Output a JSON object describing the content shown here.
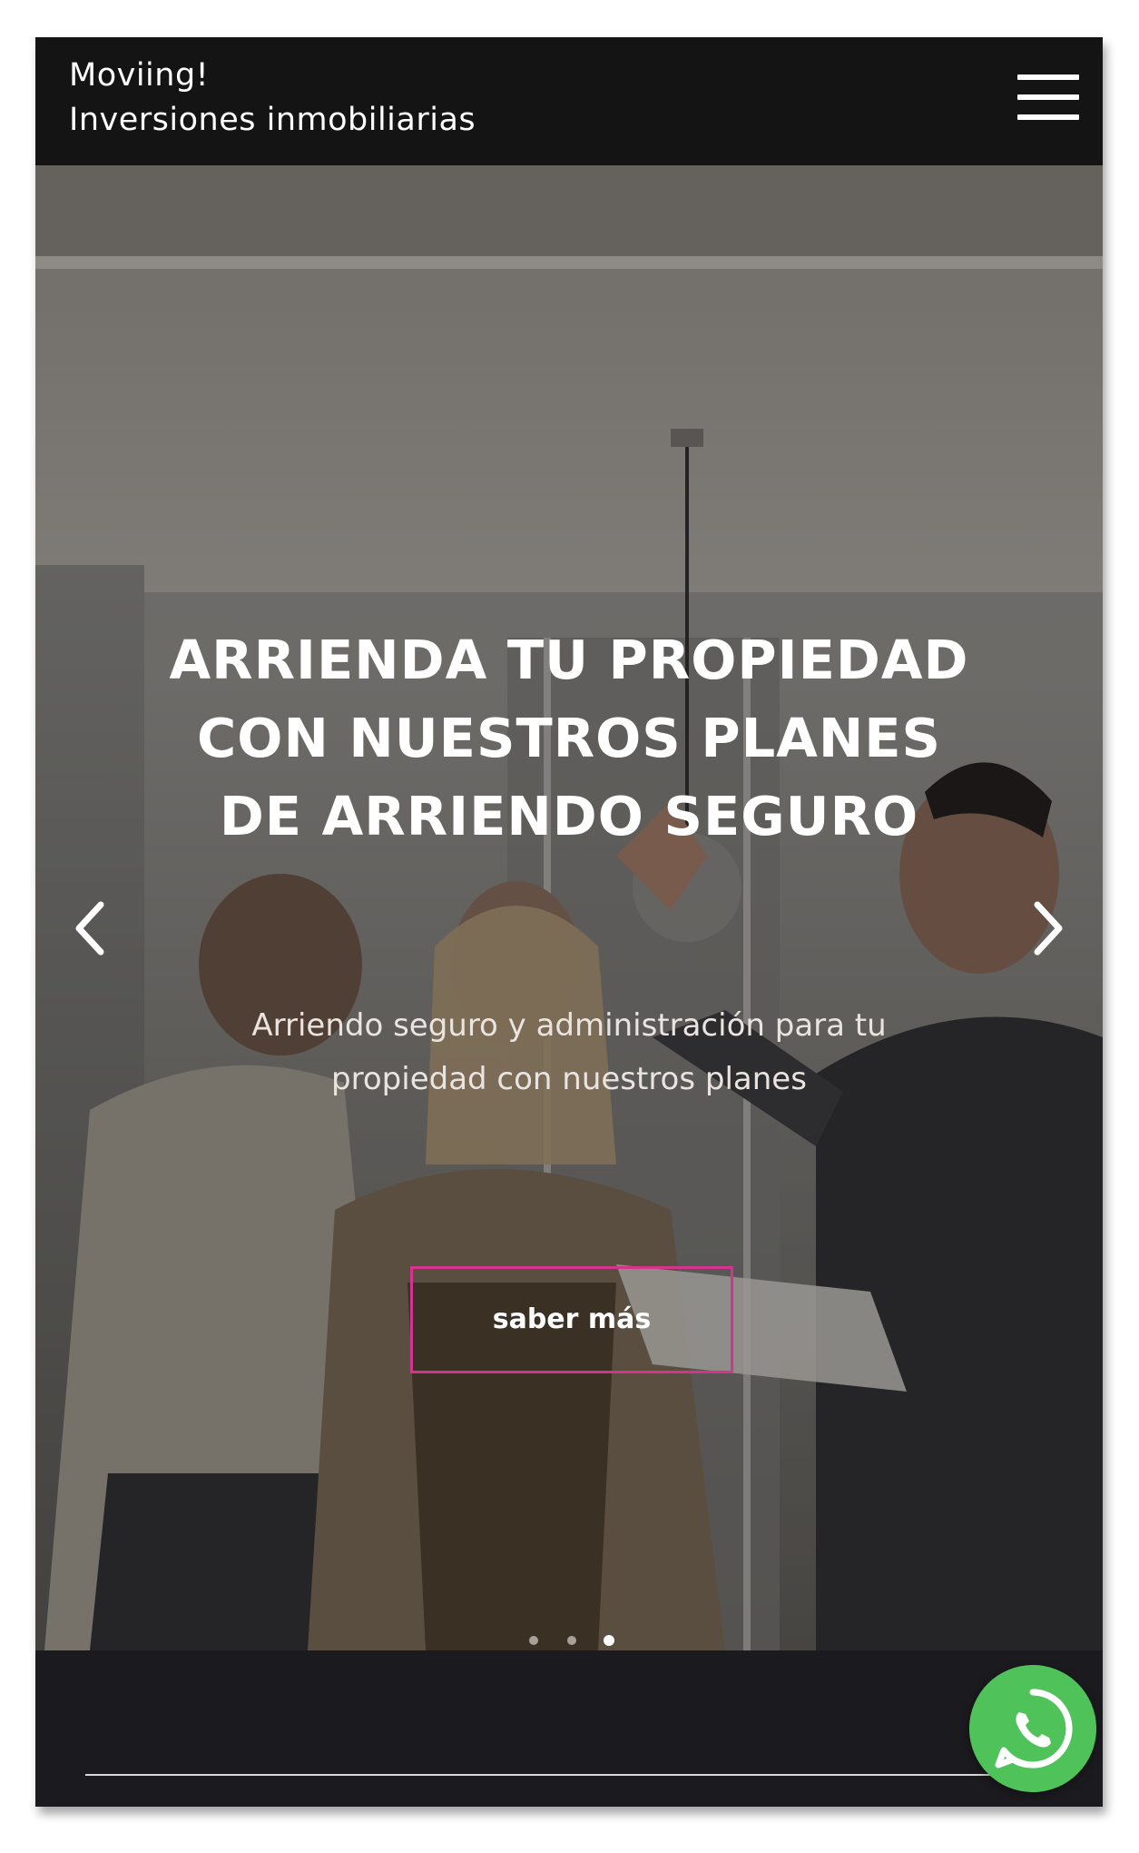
{
  "header": {
    "brand_line1": "Moviing!",
    "brand_line2": "Inversiones inmobiliarias",
    "menu_icon": "hamburger-menu-icon"
  },
  "hero": {
    "title_line1": "ARRIENDA TU PROPIEDAD",
    "title_line2": "CON NUESTROS PLANES",
    "title_line3": "DE ARRIENDO SEGURO",
    "subtitle_line1": "Arriendo seguro y administración para tu",
    "subtitle_line2": "propiedad con nuestros planes",
    "cta_label": "saber más",
    "prev_icon": "chevron-left-icon",
    "next_icon": "chevron-right-icon",
    "slides_count": 3,
    "active_slide": 3
  },
  "floating": {
    "whatsapp_icon": "whatsapp-icon"
  },
  "colors": {
    "header_bg": "#141414",
    "cta_border": "#d6338f",
    "whatsapp_green": "#4fc35a",
    "footer_bg": "#1b1b1f"
  }
}
